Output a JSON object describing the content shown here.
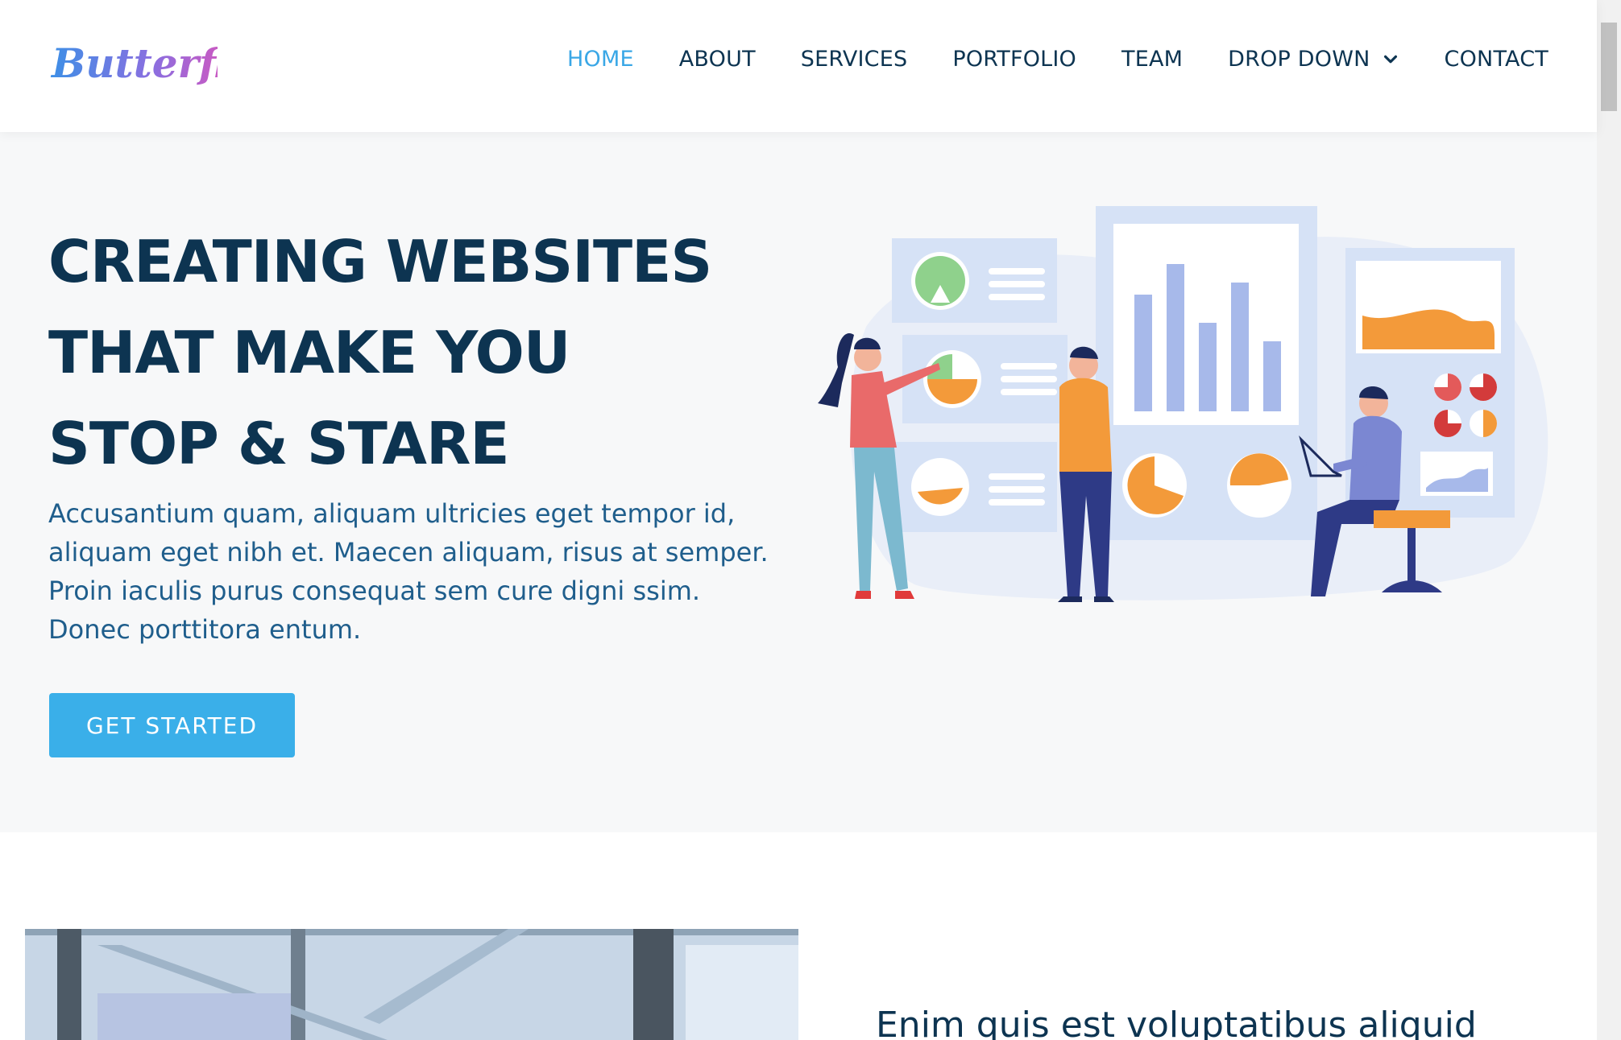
{
  "header": {
    "logo_text": "Butterfly",
    "nav": [
      {
        "label": "HOME",
        "active": true
      },
      {
        "label": "ABOUT",
        "active": false
      },
      {
        "label": "SERVICES",
        "active": false
      },
      {
        "label": "PORTFOLIO",
        "active": false
      },
      {
        "label": "TEAM",
        "active": false
      },
      {
        "label": "DROP DOWN",
        "active": false,
        "icon": "chevron-down-icon"
      },
      {
        "label": "CONTACT",
        "active": false
      }
    ]
  },
  "hero": {
    "title": "CREATING WEBSITES THAT MAKE YOU STOP & STARE",
    "text": "Accusantium quam, aliquam ultricies eget tempor id, aliquam eget nibh et. Maecen aliquam, risus at semper. Proin iaculis purus consequat sem cure digni ssim. Donec porttitora entum.",
    "button_label": "GET STARTED"
  },
  "about": {
    "heading": "Enim quis est voluptatibus aliquid"
  },
  "colors": {
    "accent": "#3aa7e6",
    "button": "#3aafe9",
    "heading": "#0d3451",
    "body_text": "#1f5e8c",
    "hero_bg": "#f7f8f9"
  }
}
